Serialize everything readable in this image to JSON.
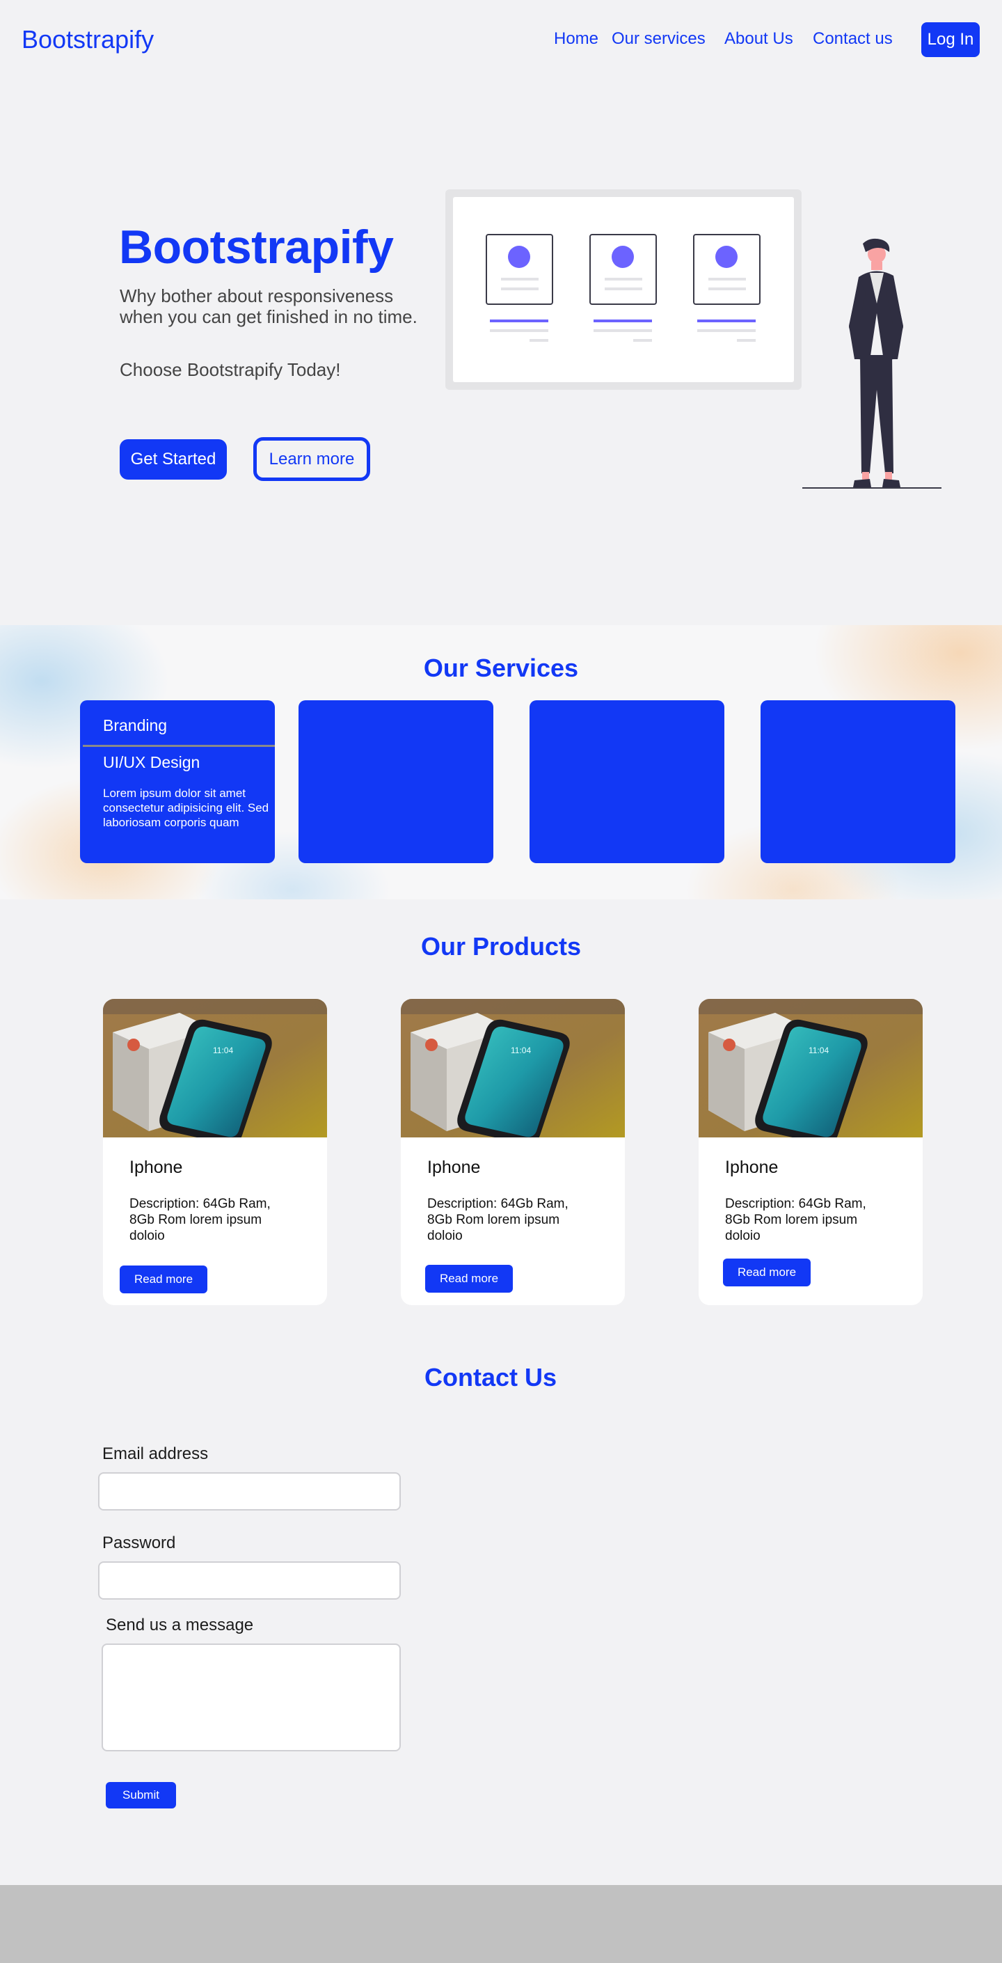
{
  "nav": {
    "brand": "Bootstrapify",
    "links": [
      "Home",
      "Our services",
      "About Us",
      "Contact us"
    ],
    "login_label": "Log In"
  },
  "hero": {
    "title": "Bootstrapify",
    "subtitle": "Why bother about responsiveness when you can get finished in no time.",
    "cta_text": "Choose Bootstrapify Today!",
    "primary_label": "Get Started",
    "secondary_label": "Learn more"
  },
  "services": {
    "title": "Our Services",
    "cards": [
      {
        "title": "Branding",
        "subtitle": "UI/UX Design",
        "description": "Lorem ipsum dolor sit amet consectetur adipisicing elit. Sed laboriosam corporis quam"
      }
    ]
  },
  "products": {
    "title": "Our Products",
    "items": [
      {
        "name": "Iphone",
        "description": "Description: 64Gb Ram, 8Gb Rom lorem ipsum doloio",
        "button": "Read more",
        "screen_time": "11:04"
      },
      {
        "name": "Iphone",
        "description": "Description: 64Gb Ram, 8Gb Rom lorem ipsum doloio",
        "button": "Read more",
        "screen_time": "11:04"
      },
      {
        "name": "Iphone",
        "description": "Description: 64Gb Ram, 8Gb Rom lorem ipsum doloio",
        "button": "Read more",
        "screen_time": "11:04"
      }
    ]
  },
  "contact": {
    "title": "Contact Us",
    "email_label": "Email address",
    "password_label": "Password",
    "message_label": "Send us a message",
    "submit_label": "Submit"
  },
  "colors": {
    "brand": "#1238f5",
    "background": "#f2f2f4",
    "footer": "#c1c1c1",
    "illustration_accent": "#6c63ff",
    "figure_suit": "#2f2e41",
    "figure_skin": "#f9a3a3"
  }
}
